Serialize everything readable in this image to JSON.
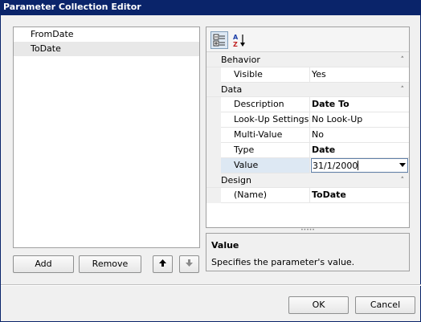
{
  "window": {
    "title": "Parameter Collection Editor"
  },
  "parameters": {
    "items": [
      {
        "label": "FromDate",
        "selected": false
      },
      {
        "label": "ToDate",
        "selected": true
      }
    ],
    "add_label": "Add",
    "remove_label": "Remove"
  },
  "toolbar": {
    "categorized_icon": "categorized-icon",
    "alphabetical_icon": "sort-az-icon"
  },
  "property_grid": {
    "categories": [
      {
        "name": "Behavior",
        "properties": [
          {
            "name": "Visible",
            "value": "Yes",
            "bold": false
          }
        ]
      },
      {
        "name": "Data",
        "properties": [
          {
            "name": "Description",
            "value": "Date To",
            "bold": true
          },
          {
            "name": "Look-Up Settings",
            "value": "No Look-Up",
            "bold": false
          },
          {
            "name": "Multi-Value",
            "value": "No",
            "bold": false
          },
          {
            "name": "Type",
            "value": "Date",
            "bold": true
          },
          {
            "name": "Value",
            "value": "31/1/2000",
            "bold": false,
            "selected": true
          }
        ]
      },
      {
        "name": "Design",
        "properties": [
          {
            "name": "(Name)",
            "value": "ToDate",
            "bold": true
          }
        ]
      }
    ]
  },
  "help": {
    "title": "Value",
    "description": "Specifies the parameter's value."
  },
  "dialog": {
    "ok_label": "OK",
    "cancel_label": "Cancel"
  },
  "colors": {
    "titlebar": "#0a246a",
    "selection": "#dde8f3"
  }
}
